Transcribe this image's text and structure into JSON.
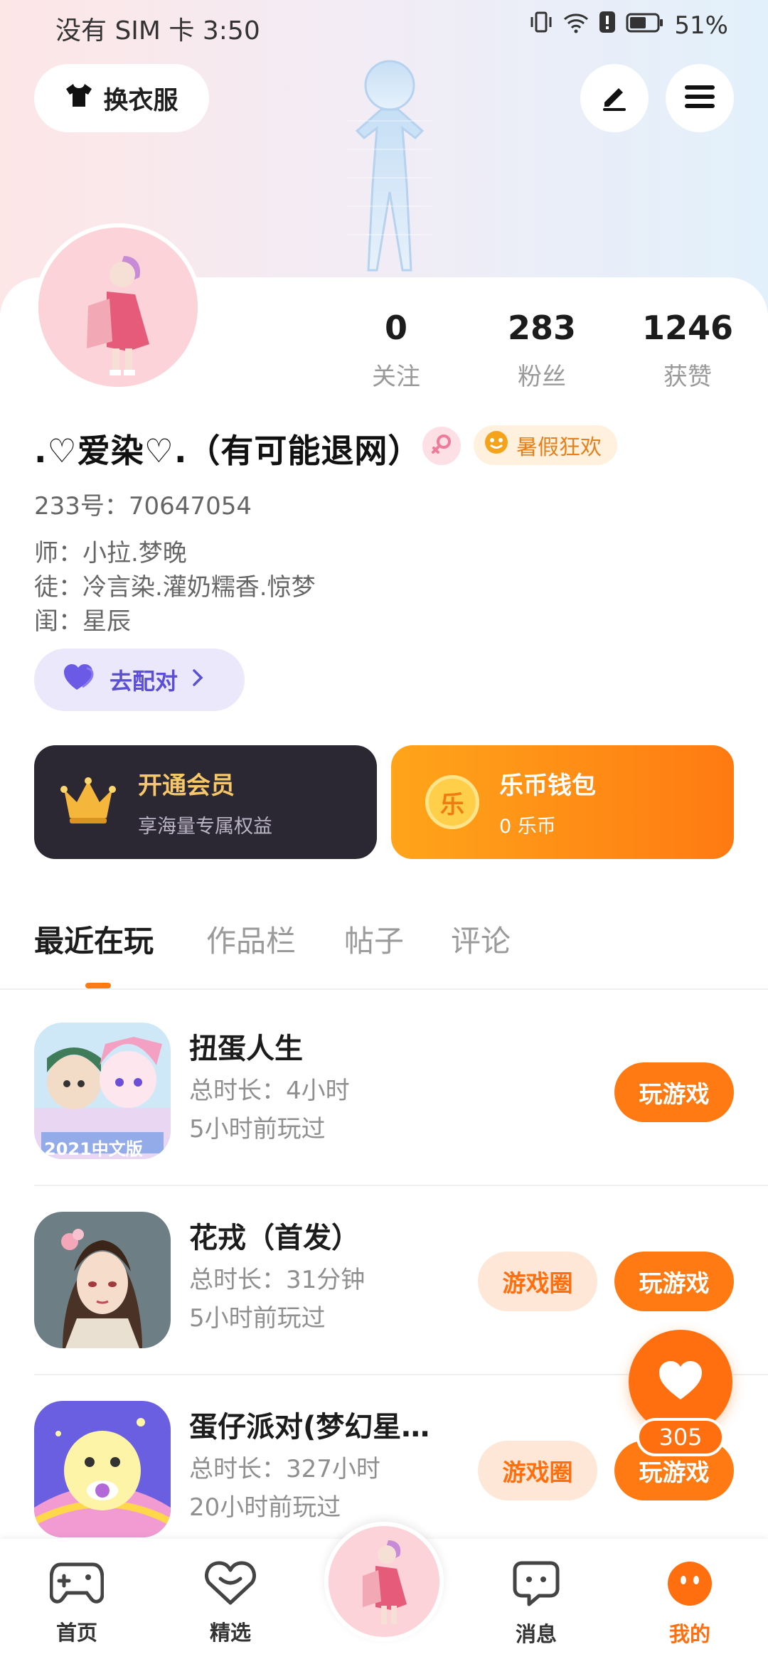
{
  "status_bar": {
    "carrier": "没有 SIM 卡",
    "time": "3:50",
    "battery": "51%"
  },
  "header": {
    "outfit_label": "换衣服"
  },
  "stats": [
    {
      "value": "0",
      "label": "关注"
    },
    {
      "value": "283",
      "label": "粉丝"
    },
    {
      "value": "1246",
      "label": "获赞"
    }
  ],
  "profile": {
    "nickname": ".♡爱染♡.（有可能退网）",
    "badge": "暑假狂欢",
    "id_label": "233号：",
    "id_value": "70647054",
    "master_label": "师：",
    "master_value": "小拉.梦晚",
    "apprentice_label": "徒：",
    "apprentice_value": "冷言染.灌奶糯香.惊梦",
    "bestie_label": "闺：",
    "bestie_value": "星辰",
    "pair_label": "去配对"
  },
  "promo": {
    "vip_title": "开通会员",
    "vip_sub": "享海量专属权益",
    "wallet_title": "乐币钱包",
    "wallet_sub": "0 乐币",
    "coin_glyph": "乐"
  },
  "tabs": [
    "最近在玩",
    "作品栏",
    "帖子",
    "评论"
  ],
  "games": [
    {
      "name": "扭蛋人生",
      "duration": "总时长：4小时",
      "last": "5小时前玩过",
      "play": "玩游戏",
      "circle": "",
      "icon_text": "2021中文版"
    },
    {
      "name": "花戎（首发）",
      "duration": "总时长：31分钟",
      "last": "5小时前玩过",
      "play": "玩游戏",
      "circle": "游戏圈"
    },
    {
      "name": "蛋仔派对(梦幻星…",
      "duration": "总时长：327小时",
      "last": "20小时前玩过",
      "play": "玩游戏",
      "circle": "游戏圈"
    }
  ],
  "fab": {
    "count": "305"
  },
  "nav": [
    {
      "label": "首页",
      "icon": "gamepad-icon"
    },
    {
      "label": "精选",
      "icon": "heart-chat-icon"
    },
    {
      "label": "",
      "icon": "avatar-center"
    },
    {
      "label": "消息",
      "icon": "message-icon"
    },
    {
      "label": "我的",
      "icon": "profile-face-icon"
    }
  ],
  "colors": {
    "accent": "#ff7a12",
    "vip_bg": "#2b2733",
    "pair": "#5a4fd6"
  }
}
